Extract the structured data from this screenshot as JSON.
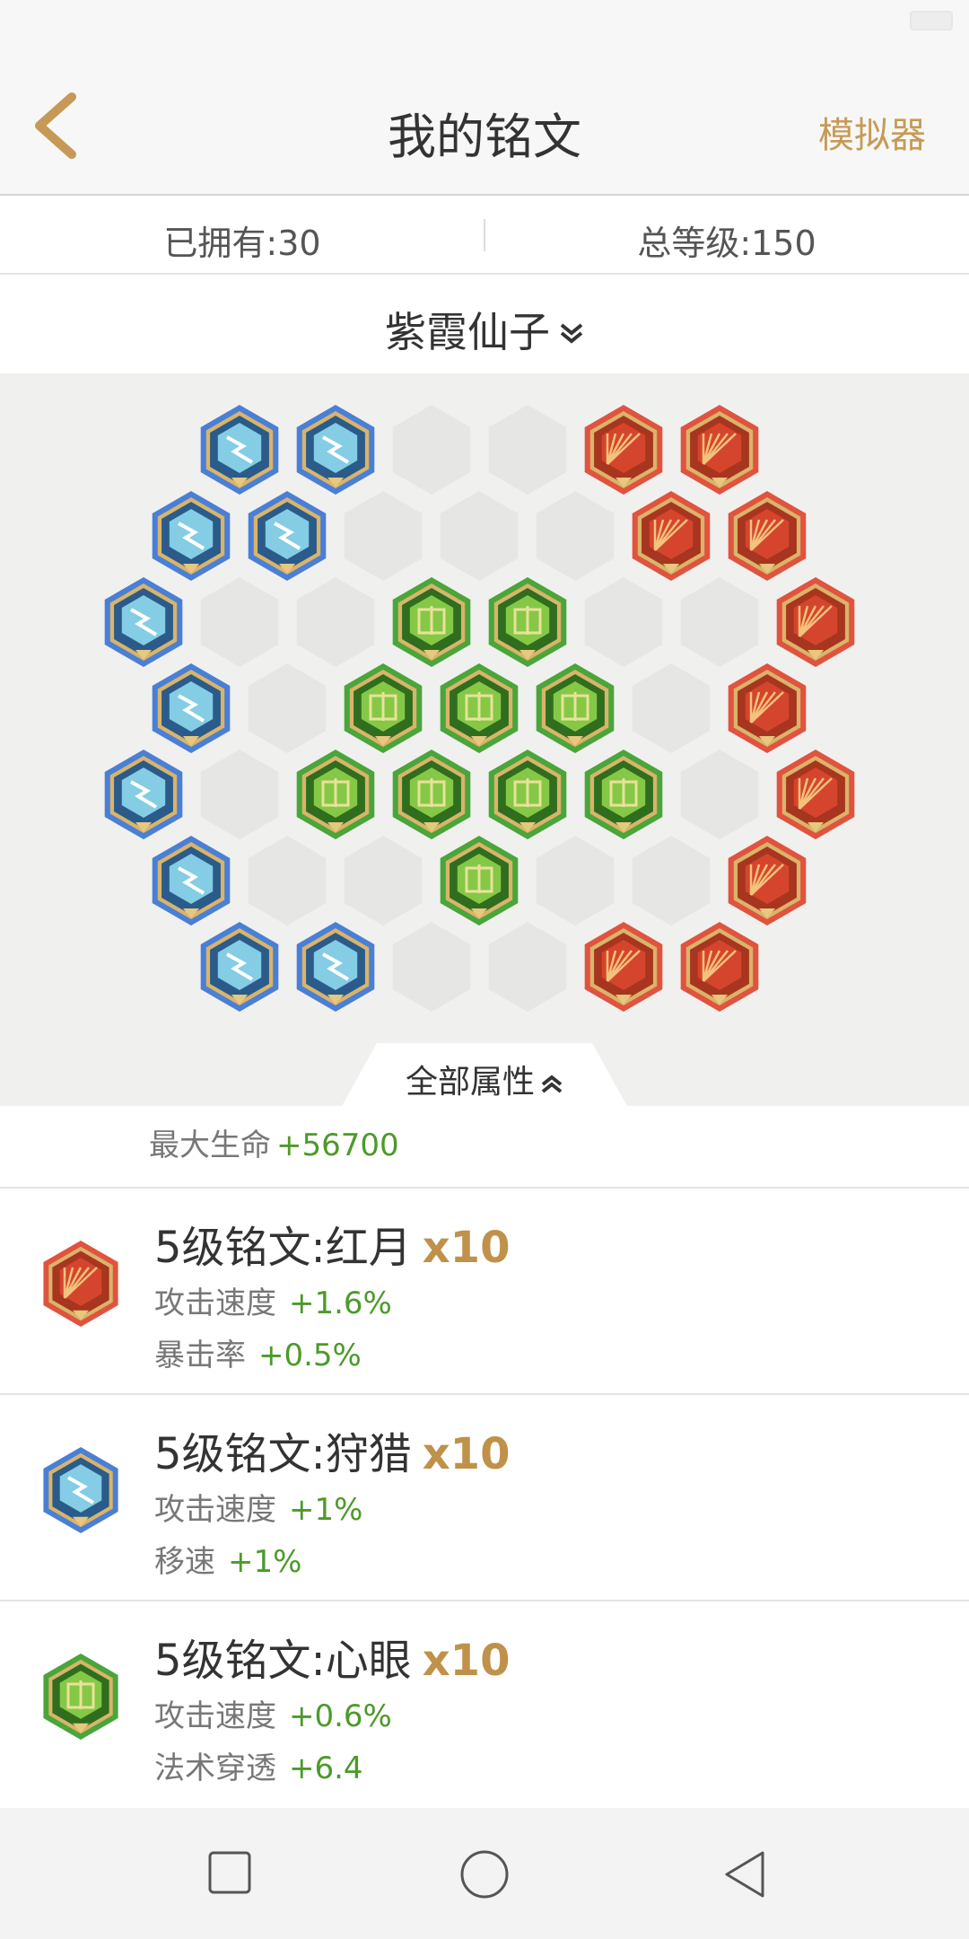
{
  "status_bar": {
    "left": "",
    "time": "",
    "battery": ""
  },
  "nav": {
    "title": "我的铭文",
    "action": "模拟器"
  },
  "stats": {
    "owned": "已拥有:30",
    "total_level": "总等级:150"
  },
  "hero": {
    "name": "紫霞仙子"
  },
  "board": {
    "colors": {
      "blue": "#4a7fd6",
      "red": "#e0533f",
      "green": "#4aa53a",
      "empty": "#e6e6e5"
    },
    "layout_note": "",
    "slots": [
      {
        "row": 0,
        "col": 0,
        "type": "blue"
      },
      {
        "row": 0,
        "col": 1,
        "type": "blue"
      },
      {
        "row": 0,
        "col": 2,
        "type": "empty"
      },
      {
        "row": 0,
        "col": 3,
        "type": "empty"
      },
      {
        "row": 0,
        "col": 4,
        "type": "red"
      },
      {
        "row": 0,
        "col": 5,
        "type": "red"
      },
      {
        "row": 1,
        "col": 0,
        "type": "blue"
      },
      {
        "row": 1,
        "col": 1,
        "type": "blue"
      },
      {
        "row": 1,
        "col": 2,
        "type": "empty"
      },
      {
        "row": 1,
        "col": 3,
        "type": "empty"
      },
      {
        "row": 1,
        "col": 4,
        "type": "empty"
      },
      {
        "row": 1,
        "col": 5,
        "type": "red"
      },
      {
        "row": 1,
        "col": 6,
        "type": "red"
      },
      {
        "row": 2,
        "col": 0,
        "type": "blue"
      },
      {
        "row": 2,
        "col": 1,
        "type": "empty"
      },
      {
        "row": 2,
        "col": 2,
        "type": "empty"
      },
      {
        "row": 2,
        "col": 3,
        "type": "green"
      },
      {
        "row": 2,
        "col": 4,
        "type": "green"
      },
      {
        "row": 2,
        "col": 5,
        "type": "empty"
      },
      {
        "row": 2,
        "col": 6,
        "type": "empty"
      },
      {
        "row": 2,
        "col": 7,
        "type": "red"
      },
      {
        "row": 3,
        "col": 0,
        "type": "blue"
      },
      {
        "row": 3,
        "col": 1,
        "type": "empty"
      },
      {
        "row": 3,
        "col": 2,
        "type": "green"
      },
      {
        "row": 3,
        "col": 3,
        "type": "green"
      },
      {
        "row": 3,
        "col": 4,
        "type": "green"
      },
      {
        "row": 3,
        "col": 5,
        "type": "empty"
      },
      {
        "row": 3,
        "col": 6,
        "type": "red"
      },
      {
        "row": 4,
        "col": 0,
        "type": "blue"
      },
      {
        "row": 4,
        "col": 1,
        "type": "empty"
      },
      {
        "row": 4,
        "col": 2,
        "type": "green"
      },
      {
        "row": 4,
        "col": 3,
        "type": "green"
      },
      {
        "row": 4,
        "col": 4,
        "type": "green"
      },
      {
        "row": 4,
        "col": 5,
        "type": "green"
      },
      {
        "row": 4,
        "col": 6,
        "type": "empty"
      },
      {
        "row": 4,
        "col": 7,
        "type": "red"
      },
      {
        "row": 5,
        "col": 0,
        "type": "blue"
      },
      {
        "row": 5,
        "col": 1,
        "type": "empty"
      },
      {
        "row": 5,
        "col": 2,
        "type": "empty"
      },
      {
        "row": 5,
        "col": 3,
        "type": "green"
      },
      {
        "row": 5,
        "col": 4,
        "type": "empty"
      },
      {
        "row": 5,
        "col": 5,
        "type": "empty"
      },
      {
        "row": 5,
        "col": 6,
        "type": "red"
      },
      {
        "row": 6,
        "col": 0,
        "type": "blue"
      },
      {
        "row": 6,
        "col": 1,
        "type": "blue"
      },
      {
        "row": 6,
        "col": 2,
        "type": "empty"
      },
      {
        "row": 6,
        "col": 3,
        "type": "empty"
      },
      {
        "row": 6,
        "col": 4,
        "type": "red"
      },
      {
        "row": 6,
        "col": 5,
        "type": "red"
      }
    ]
  },
  "attributes": {
    "toggle_label": "全部属性",
    "summary_label": "最大生命",
    "summary_value": "+56700"
  },
  "runes": [
    {
      "title": "5级铭文:红月",
      "count": "x10",
      "color": "red",
      "attrs": [
        {
          "label": "攻击速度",
          "value": "+1.6%"
        },
        {
          "label": "暴击率",
          "value": "+0.5%"
        }
      ]
    },
    {
      "title": "5级铭文:狩猎",
      "count": "x10",
      "color": "blue",
      "attrs": [
        {
          "label": "攻击速度",
          "value": "+1%"
        },
        {
          "label": "移速",
          "value": "+1%"
        }
      ]
    },
    {
      "title": "5级铭文:心眼",
      "count": "x10",
      "color": "green",
      "attrs": [
        {
          "label": "攻击速度",
          "value": "+0.6%"
        },
        {
          "label": "法术穿透",
          "value": "+6.4"
        }
      ]
    }
  ],
  "icons": {
    "back": "chevron-left-icon",
    "dropdown": "double-chevron-down-icon",
    "collapse": "double-chevron-up-icon",
    "nav_recent": "square-icon",
    "nav_home": "circle-icon",
    "nav_back": "triangle-back-icon"
  }
}
